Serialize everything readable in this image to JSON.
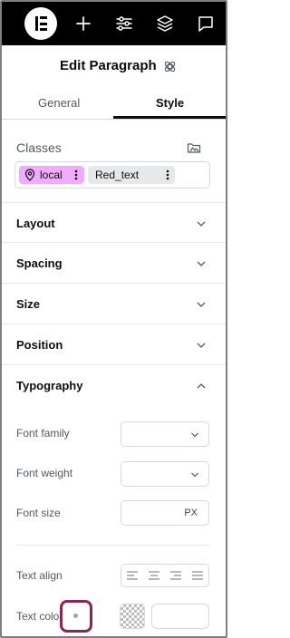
{
  "header": {
    "title": "Edit Paragraph",
    "icons": [
      "elementor-logo-icon",
      "add-icon",
      "sliders-icon",
      "layers-icon",
      "comment-icon"
    ]
  },
  "tabs": [
    {
      "label": "General",
      "active": false
    },
    {
      "label": "Style",
      "active": true
    }
  ],
  "classes": {
    "label": "Classes",
    "chips": [
      {
        "label": "local",
        "color": "#f0abfc"
      },
      {
        "label": "Red_text",
        "color": "#e6e8ea"
      }
    ]
  },
  "sections": [
    {
      "label": "Layout",
      "expanded": false
    },
    {
      "label": "Spacing",
      "expanded": false
    },
    {
      "label": "Size",
      "expanded": false
    },
    {
      "label": "Position",
      "expanded": false
    },
    {
      "label": "Typography",
      "expanded": true
    }
  ],
  "typography": {
    "font_family_label": "Font family",
    "font_weight_label": "Font weight",
    "font_size_label": "Font size",
    "font_size_unit": "PX",
    "text_align_label": "Text align",
    "text_color_label": "Text color"
  },
  "colors": {
    "topbar": "#000000",
    "local_chip": "#f0abfc",
    "highlight": "#8c2651"
  }
}
